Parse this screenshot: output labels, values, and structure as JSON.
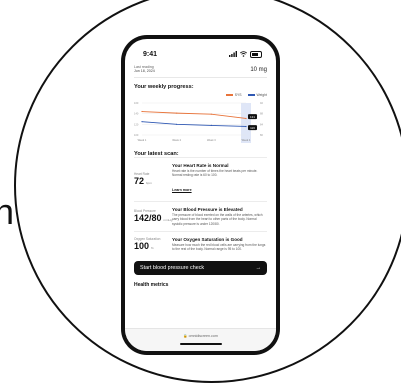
{
  "background_text": "n",
  "status_bar": {
    "time": "9:41",
    "signal_icon": "signal-icon",
    "wifi_icon": "wifi-icon",
    "battery_icon": "battery-icon"
  },
  "top": {
    "date_label": "Last reading",
    "date": "Jun 18, 2024",
    "dose": "10 mg"
  },
  "progress": {
    "title": "Your weekly progress:",
    "legend": {
      "series_a": "SYS",
      "series_b": "Weight"
    }
  },
  "chart_data": {
    "type": "line",
    "categories": [
      "Week 1",
      "Week 2",
      "Week 3",
      "Week 4"
    ],
    "series": [
      {
        "name": "SYS",
        "color": "#e8743b",
        "values": [
          144,
          141,
          139,
          131
        ]
      },
      {
        "name": "Weight",
        "color": "#2f58b3",
        "values": [
          125,
          120,
          118,
          116
        ]
      }
    ],
    "ylim": [
      100,
      160
    ],
    "y_ticks_left": [
      "160",
      "140",
      "120",
      "100"
    ],
    "y_ticks_right": [
      "92",
      "88",
      "84",
      "80"
    ],
    "value_labels": [
      "131",
      "116"
    ],
    "highlight_category": "Week 4"
  },
  "scan": {
    "title": "Your latest scan:"
  },
  "cards": [
    {
      "label": "Heart Rate",
      "value": "72",
      "unit": "bpm",
      "title": "Your Heart Rate is Normal",
      "desc": "Heart rate is the number of times the heart beats per minute. Normal resting rate is 60 to 100.",
      "link": "Learn more"
    },
    {
      "label": "Blood Pressure",
      "value": "142/80",
      "unit": "mmHg",
      "title": "Your Blood Pressure is Elevated",
      "desc": "The pressure of blood exerted on the walls of the arteries, which carry blood from the heart to other parts of the body. Normal systolic pressure is under 120/80."
    },
    {
      "label": "Oxygen Saturation",
      "value": "100",
      "unit": "%",
      "title": "Your Oxygen Saturation is Good",
      "desc": "Measure how much the red blood cells are carrying from the lungs to the rest of the body. Normal range is 95 to 100."
    }
  ],
  "cta": {
    "label": "Start blood pressure check",
    "arrow": "→"
  },
  "health": {
    "title": "Health metrics"
  },
  "browser": {
    "url": "omnidiscreen.com"
  }
}
